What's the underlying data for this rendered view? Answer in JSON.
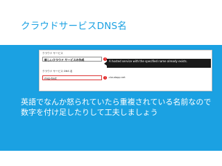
{
  "slide": {
    "title": "クラウドサービスDNS名",
    "body_lines": [
      "英語でなんか怒られていたら重複されている名前なので",
      "数字を付け足したりして工夫しましょう"
    ],
    "accent_color": "#1ba1e2"
  },
  "form": {
    "service_label": "クラウド サービス",
    "service_value": "新しいクラウド サービスの作成",
    "dns_label": "クラウド サービス DNS 名",
    "dns_value": "msp-test",
    "dns_suffix": ".cloudapp.net",
    "error_tooltip": "A hosted service with the specified name already exists.",
    "warning_icon": "exclamation-icon"
  }
}
